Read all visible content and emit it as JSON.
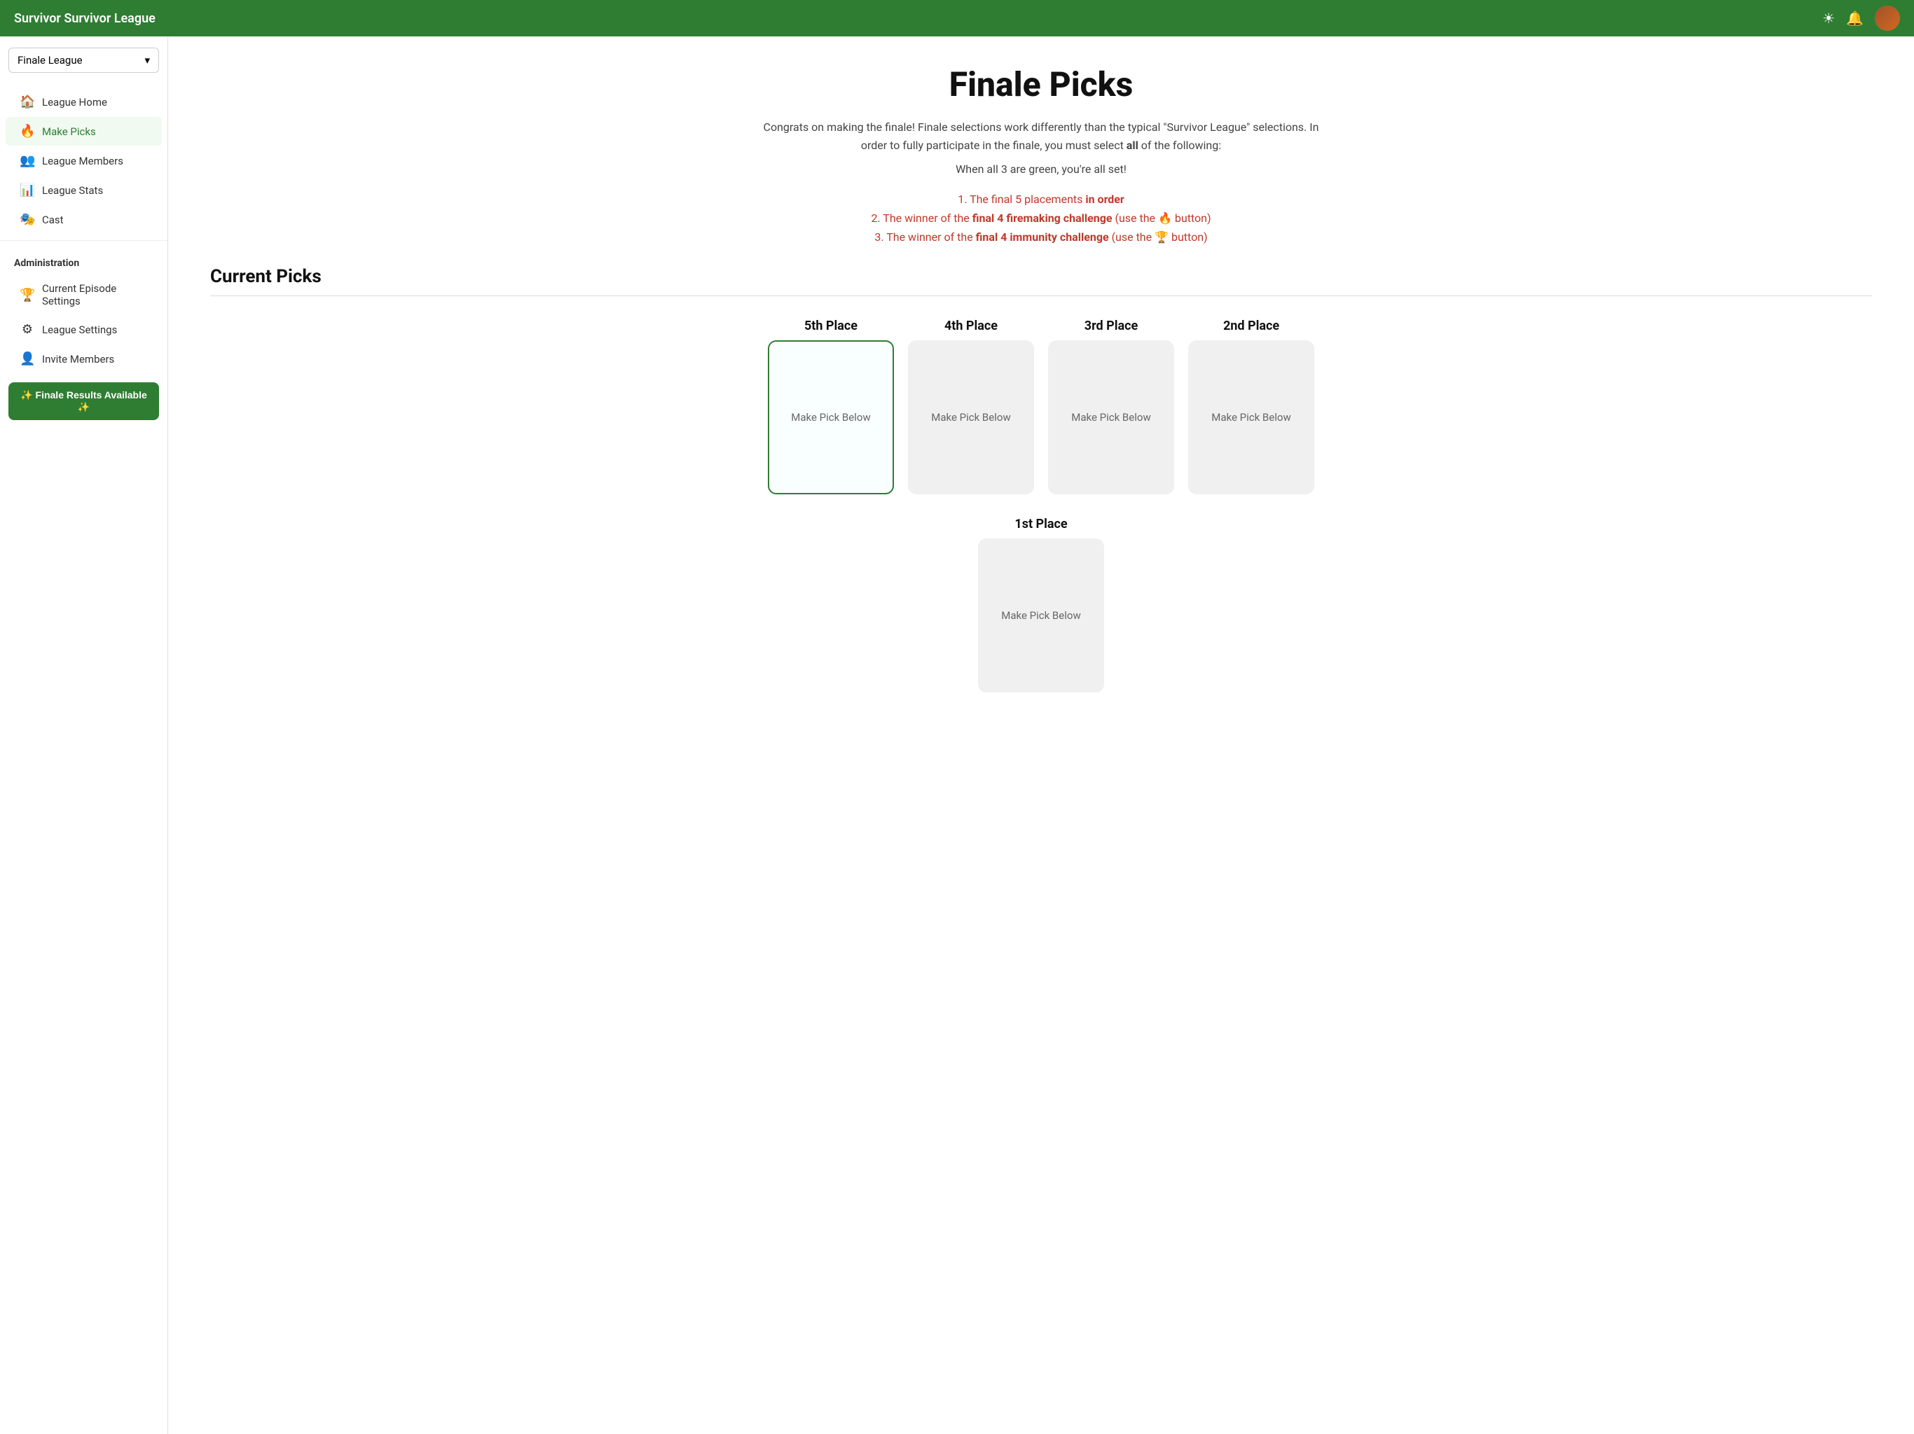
{
  "app": {
    "title": "Survivor Survivor League"
  },
  "topnav": {
    "title": "Survivor Survivor League",
    "sun_icon": "☀",
    "bell_icon": "🔔"
  },
  "sidebar": {
    "league_selector": {
      "label": "Finale League",
      "chevron": "▾"
    },
    "nav_items": [
      {
        "id": "league-home",
        "label": "League Home",
        "icon": "🏠",
        "active": false
      },
      {
        "id": "make-picks",
        "label": "Make Picks",
        "icon": "🔥",
        "active": true
      },
      {
        "id": "league-members",
        "label": "League Members",
        "icon": "👥",
        "active": false
      },
      {
        "id": "league-stats",
        "label": "League Stats",
        "icon": "📊",
        "active": false
      },
      {
        "id": "cast",
        "label": "Cast",
        "icon": "🎭",
        "active": false
      }
    ],
    "admin_title": "Administration",
    "admin_items": [
      {
        "id": "episode-settings",
        "label": "Current Episode Settings",
        "icon": "🏆"
      },
      {
        "id": "league-settings",
        "label": "League Settings",
        "icon": "⚙"
      },
      {
        "id": "invite-members",
        "label": "Invite Members",
        "icon": "👤"
      }
    ],
    "finale_btn": "✨ Finale Results Available ✨"
  },
  "main": {
    "page_title": "Finale Picks",
    "subtitle_part1": "Congrats on making the finale! Finale selections work differently than the typical \"Survivor League\" selections. In order to fully participate in the finale, you must select ",
    "subtitle_bold": "all",
    "subtitle_part2": " of the following:",
    "green_note": "When all 3 are green, you're all set!",
    "requirements": [
      {
        "text": "1. The final 5 placements ",
        "bold": "in order",
        "suffix": ""
      },
      {
        "text": "2. The winner of the ",
        "bold": "final 4 firemaking challenge",
        "suffix": " (use the 🔥 button)"
      },
      {
        "text": "3. The winner of the ",
        "bold": "final 4 immunity challenge",
        "suffix": " (use the 🏆 button)"
      }
    ],
    "current_picks_title": "Current Picks",
    "placements": [
      {
        "label": "5th Place",
        "card_text": "Make Pick Below",
        "selected": true
      },
      {
        "label": "4th Place",
        "card_text": "Make Pick Below",
        "selected": false
      },
      {
        "label": "3rd Place",
        "card_text": "Make Pick Below",
        "selected": false
      },
      {
        "label": "2nd Place",
        "card_text": "Make Pick Below",
        "selected": false
      }
    ],
    "first_place": {
      "label": "1st Place",
      "card_text": "Make Pick Below"
    }
  }
}
